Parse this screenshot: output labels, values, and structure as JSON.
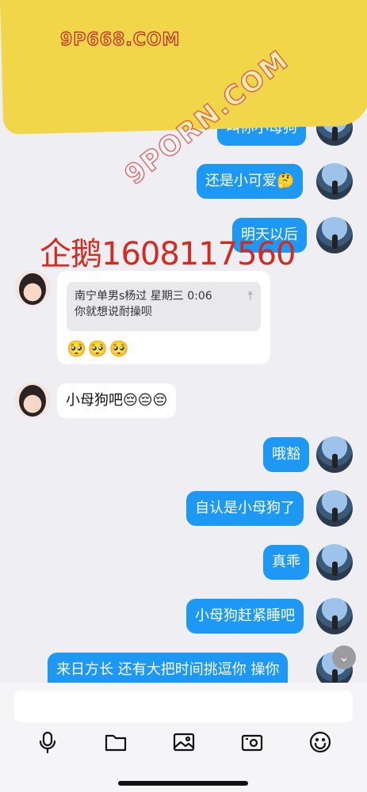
{
  "watermarks": {
    "site": "9P668.COM",
    "diagonal": "9PORN.COM",
    "qq": "企鹅1608117560"
  },
  "messages": [
    {
      "side": "out",
      "text": "叫你小母狗"
    },
    {
      "side": "out",
      "text": "还是小可爱🤔"
    },
    {
      "side": "out",
      "text": "明天以后"
    },
    {
      "side": "in",
      "quote": {
        "header": "南宁单男s杨过  星期三 0:06",
        "body": "你就想说耐操呗",
        "pin": "⤒"
      },
      "text": "🥺🥺🥺"
    },
    {
      "side": "in",
      "text": "小母狗吧😔😔😔"
    },
    {
      "side": "out",
      "text": "哦豁"
    },
    {
      "side": "out",
      "text": "自认是小母狗了"
    },
    {
      "side": "out",
      "text": "真乖"
    },
    {
      "side": "out",
      "text": "小母狗赶紧睡吧"
    },
    {
      "side": "out",
      "text": "来日方长  还有大把时间挑逗你  操你"
    }
  ],
  "input": {
    "placeholder": "",
    "value": ""
  },
  "toolbar_icons": [
    "microphone-icon",
    "folder-icon",
    "image-icon",
    "camera-icon",
    "emoji-icon"
  ],
  "scroll_icon": "⌄",
  "colors": {
    "accent": "#1e98f5",
    "banner": "#f2d64a"
  }
}
